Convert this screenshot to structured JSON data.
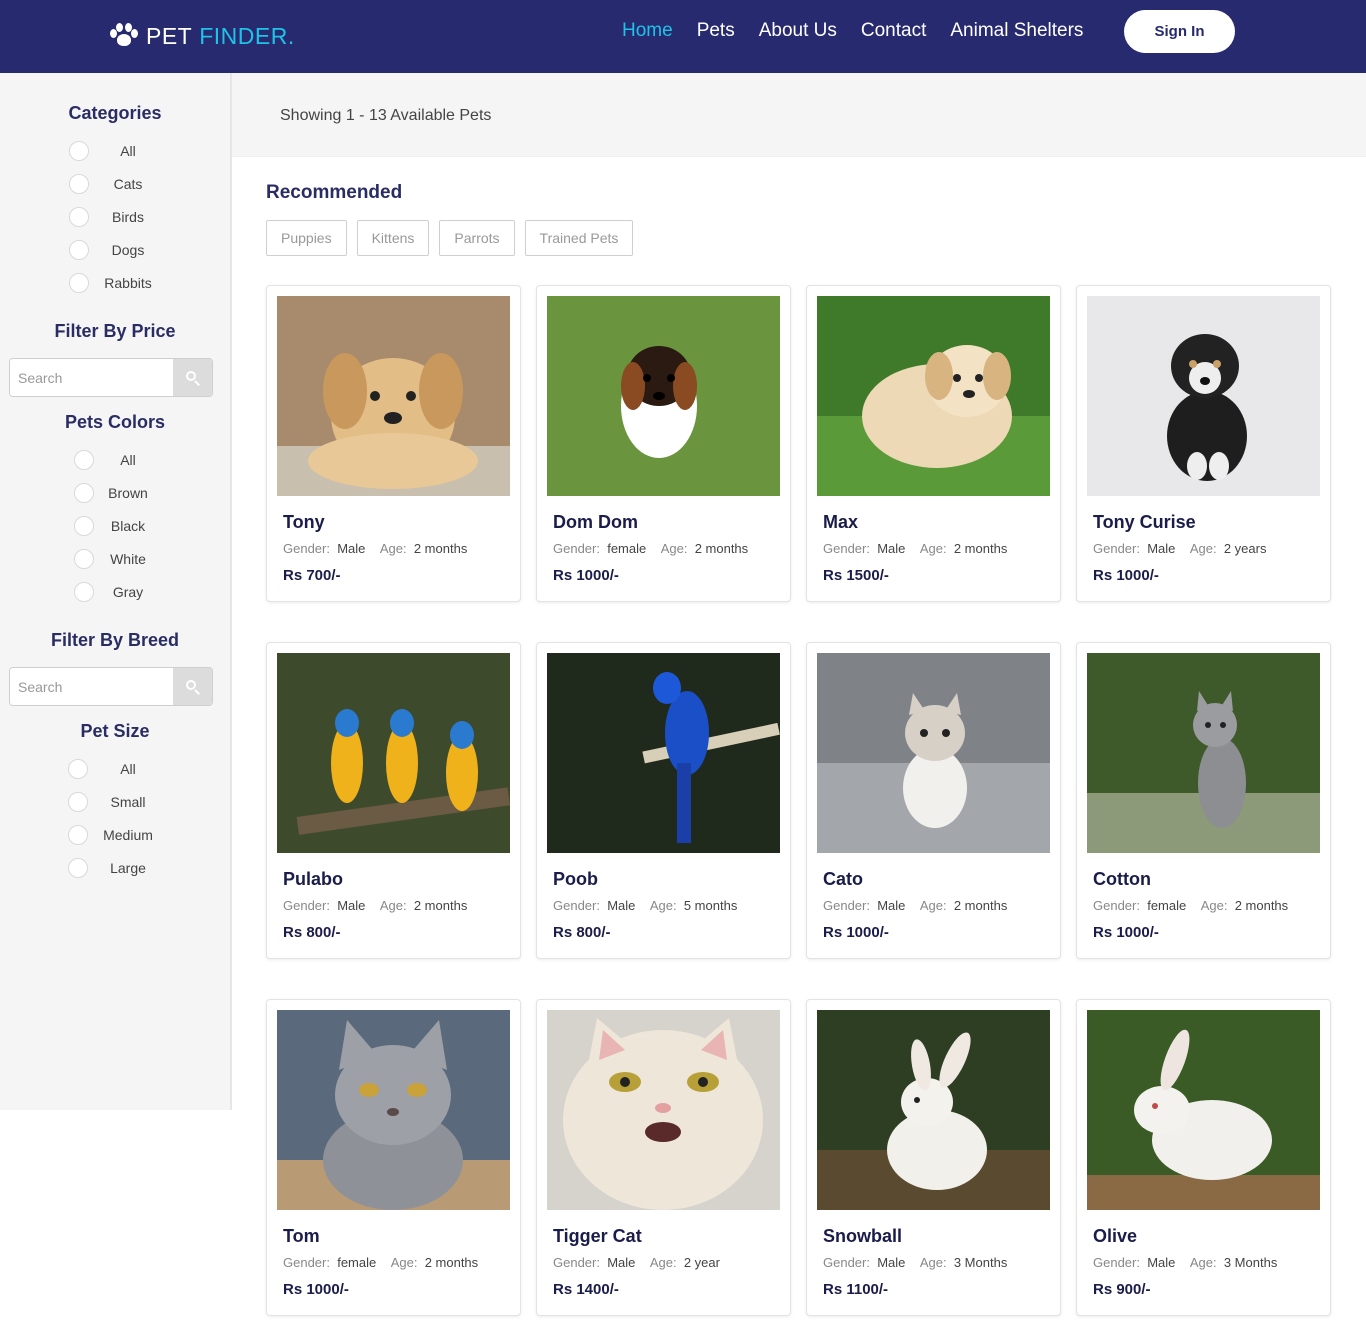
{
  "nav": {
    "brand_left": "PET",
    "brand_right": "FINDER.",
    "links": [
      "Home",
      "Pets",
      "About Us",
      "Contact",
      "Animal Shelters"
    ],
    "signin": "Sign In",
    "brand_color": "#272a6e",
    "accent_color": "#1ec3e8"
  },
  "sidebar": {
    "categories": {
      "title": "Categories",
      "options": [
        "All",
        "Cats",
        "Birds",
        "Dogs",
        "Rabbits"
      ]
    },
    "price": {
      "title": "Filter By Price",
      "placeholder": "Search"
    },
    "colors": {
      "title": "Pets Colors",
      "options": [
        "All",
        "Brown",
        "Black",
        "White",
        "Gray"
      ]
    },
    "breed": {
      "title": "Filter By Breed",
      "placeholder": "Search"
    },
    "size": {
      "title": "Pet Size",
      "options": [
        "All",
        "Small",
        "Medium",
        "Large"
      ]
    }
  },
  "main": {
    "showing": "Showing 1 - 13 Available Pets",
    "recommended": "Recommended",
    "chips": [
      "Puppies",
      "Kittens",
      "Parrots",
      "Trained Pets"
    ],
    "gender_label": "Gender:",
    "age_label": "Age:"
  },
  "pets": [
    {
      "name": "Tony",
      "gender": "Male",
      "age": "2 months",
      "price": "Rs 700/-"
    },
    {
      "name": "Dom Dom",
      "gender": "female",
      "age": "2 months",
      "price": "Rs 1000/-"
    },
    {
      "name": "Max",
      "gender": "Male",
      "age": "2 months",
      "price": "Rs 1500/-"
    },
    {
      "name": "Tony Curise",
      "gender": "Male",
      "age": "2 years",
      "price": "Rs 1000/-"
    },
    {
      "name": "Pulabo",
      "gender": "Male",
      "age": "2 months",
      "price": "Rs 800/-"
    },
    {
      "name": "Poob",
      "gender": "Male",
      "age": "5 months",
      "price": "Rs 800/-"
    },
    {
      "name": "Cato",
      "gender": "Male",
      "age": "2 months",
      "price": "Rs 1000/-"
    },
    {
      "name": "Cotton",
      "gender": "female",
      "age": "2 months",
      "price": "Rs 1000/-"
    },
    {
      "name": "Tom",
      "gender": "female",
      "age": "2 months",
      "price": "Rs 1000/-"
    },
    {
      "name": "Tigger Cat",
      "gender": "Male",
      "age": "2 year",
      "price": "Rs 1400/-"
    },
    {
      "name": "Snowball",
      "gender": "Male",
      "age": "3 Months",
      "price": "Rs 1100/-"
    },
    {
      "name": "Olive",
      "gender": "Male",
      "age": "3 Months",
      "price": "Rs 900/-"
    }
  ]
}
